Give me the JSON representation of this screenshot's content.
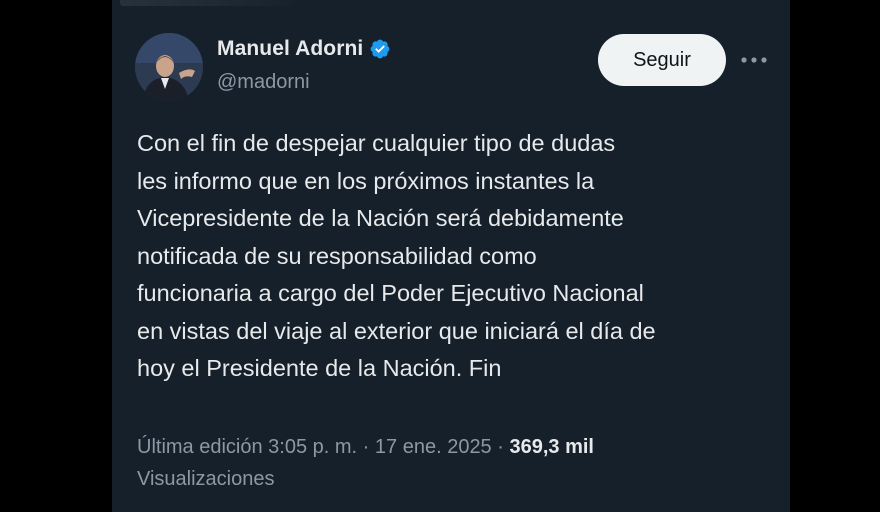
{
  "author": {
    "name": "Manuel Adorni",
    "handle": "@madorni",
    "verified": true
  },
  "actions": {
    "follow_label": "Seguir",
    "more_icon": "more-dots-icon"
  },
  "tweet": {
    "text": "Con el fin de despejar cualquier tipo de dudas\nles informo que en los próximos instantes la\nVicepresidente de la Nación será debidamente\nnotificada de su responsabilidad como\nfuncionaria a cargo del Poder Ejecutivo Nacional\nen vistas del viaje al exterior que iniciará el día de\nhoy el Presidente de la Nación. Fin"
  },
  "meta": {
    "edited_label": "Última edición",
    "time": "3:05 p. m.",
    "separator": "·",
    "date": "17 ene. 2025",
    "views_count": "369,3 mil",
    "views_label": "Visualizaciones"
  },
  "colors": {
    "background": "#15202b",
    "text": "#e7e9ea",
    "muted": "#8b98a5",
    "verified": "#1d9bf0",
    "button_bg": "#eff3f4"
  }
}
